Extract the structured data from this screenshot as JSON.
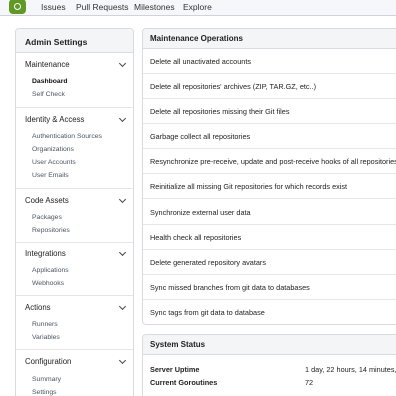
{
  "navbar": {
    "items": [
      "Issues",
      "Pull Requests",
      "Milestones",
      "Explore"
    ]
  },
  "sidebar": {
    "title": "Admin Settings",
    "groups": [
      {
        "title": "Maintenance",
        "items": [
          "Dashboard",
          "Self Check"
        ],
        "active": "Dashboard"
      },
      {
        "title": "Identity & Access",
        "items": [
          "Authentication Sources",
          "Organizations",
          "User Accounts",
          "User Emails"
        ]
      },
      {
        "title": "Code Assets",
        "items": [
          "Packages",
          "Repositories"
        ]
      },
      {
        "title": "Integrations",
        "items": [
          "Applications",
          "Webhooks"
        ]
      },
      {
        "title": "Actions",
        "items": [
          "Runners",
          "Variables"
        ]
      },
      {
        "title": "Configuration",
        "items": [
          "Summary",
          "Settings"
        ]
      }
    ]
  },
  "maintenance": {
    "title": "Maintenance Operations",
    "operations": [
      "Delete all unactivated accounts",
      "Delete all repositories' archives (ZIP, TAR.GZ, etc..)",
      "Delete all repositories missing their Git files",
      "Garbage collect all repositories",
      "Resynchronize pre-receive, update and post-receive hooks of all repositories.",
      "Reinitialize all missing Git repositories for which records exist",
      "Synchronize external user data",
      "Health check all repositories",
      "Delete generated repository avatars",
      "Sync missed branches from git data to databases",
      "Sync tags from git data to database"
    ]
  },
  "system_status": {
    "title": "System Status",
    "rows": [
      {
        "key": "Server Uptime",
        "value": "1 day, 22 hours, 14 minutes, 1"
      },
      {
        "key": "Current Goroutines",
        "value": "72"
      }
    ]
  },
  "colors": {
    "logo": "#609926",
    "panel_header": "#f4f5f7",
    "border": "#d8dbe0"
  }
}
